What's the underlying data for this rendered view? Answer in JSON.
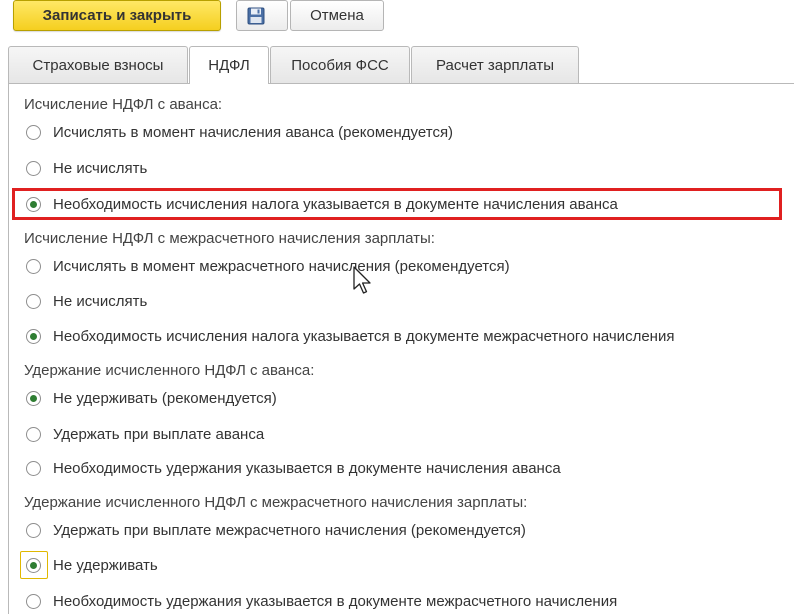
{
  "toolbar": {
    "save_close_label": "Записать и закрыть",
    "save_icon": "floppy-disk-icon",
    "cancel_label": "Отмена"
  },
  "tabs": [
    {
      "label": "Страховые взносы",
      "active": false
    },
    {
      "label": "НДФЛ",
      "active": true
    },
    {
      "label": "Пособия ФСС",
      "active": false
    },
    {
      "label": "Расчет зарплаты",
      "active": false
    }
  ],
  "groups": [
    {
      "title": "Исчисление НДФЛ с аванса:",
      "options": [
        {
          "label": "Исчислять в момент начисления аванса (рекомендуется)",
          "checked": false
        },
        {
          "label": "Не исчислять",
          "checked": false
        },
        {
          "label": "Необходимость исчисления налога указывается в документе начисления аванса",
          "checked": true
        }
      ]
    },
    {
      "title": "Исчисление НДФЛ с межрасчетного начисления зарплаты:",
      "options": [
        {
          "label": "Исчислять в момент межрасчетного начисления (рекомендуется)",
          "checked": false
        },
        {
          "label": "Не исчислять",
          "checked": false
        },
        {
          "label": "Необходимость исчисления налога указывается в документе межрасчетного начисления",
          "checked": true
        }
      ]
    },
    {
      "title": "Удержание исчисленного НДФЛ с аванса:",
      "options": [
        {
          "label": "Не удерживать (рекомендуется)",
          "checked": true
        },
        {
          "label": "Удержать при выплате аванса",
          "checked": false
        },
        {
          "label": "Необходимость удержания указывается в документе начисления аванса",
          "checked": false
        }
      ]
    },
    {
      "title": "Удержание исчисленного НДФЛ с межрасчетного начисления зарплаты:",
      "options": [
        {
          "label": "Удержать при выплате межрасчетного начисления (рекомендуется)",
          "checked": false
        },
        {
          "label": "Не удерживать",
          "checked": true
        },
        {
          "label": "Необходимость удержания указывается в документе межрасчетного начисления",
          "checked": false
        }
      ]
    }
  ],
  "colors": {
    "primary_button": "#f5cf1f",
    "radio_checked": "#2e7d32",
    "highlight": "#e02020",
    "focus": "#e0b800"
  }
}
